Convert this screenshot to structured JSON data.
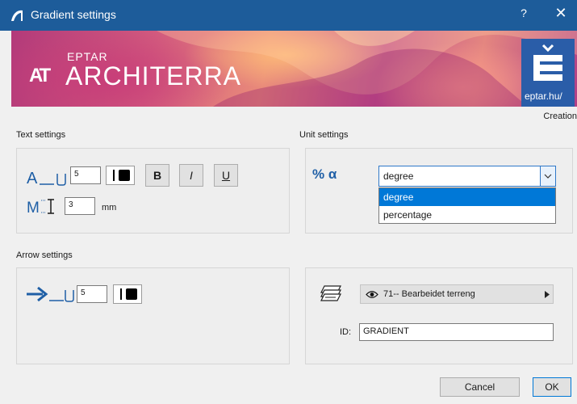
{
  "window": {
    "title": "Gradient settings",
    "help": "?",
    "close": "✕"
  },
  "banner": {
    "brand_top": "EPTAR",
    "brand_main": "ARCHITERRA",
    "brand_logo": "AT",
    "site": "eptar.hu/"
  },
  "creation_label": "Creation",
  "text_settings": {
    "label": "Text settings",
    "size_value": "5",
    "height_value": "3",
    "height_unit": "mm",
    "bold": "B",
    "italic": "I",
    "underline": "U"
  },
  "unit_settings": {
    "label": "Unit settings",
    "symbol": "% α",
    "selected": "degree",
    "options": [
      "degree",
      "percentage"
    ]
  },
  "arrow_settings": {
    "label": "Arrow settings",
    "size_value": "5"
  },
  "layer": {
    "value": "71-- Bearbeidet terreng",
    "id_label": "ID:",
    "id_value": "GRADIENT"
  },
  "buttons": {
    "cancel": "Cancel",
    "ok": "OK"
  },
  "colors": {
    "titlebar": "#1d5c9a",
    "accent": "#2f78c8",
    "arrow": "#1f5fa6"
  }
}
